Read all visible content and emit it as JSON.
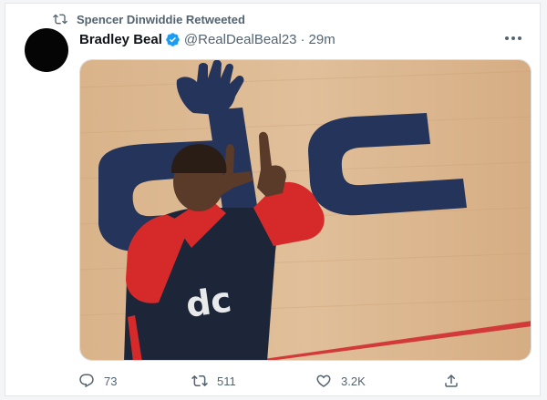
{
  "retweet": {
    "label": "Spencer Dinwiddie Retweeted",
    "icon": "retweet-icon"
  },
  "tweet": {
    "display_name": "Bradley Beal",
    "handle": "@RealDealBeal23",
    "separator": "·",
    "time": "29m",
    "verified": true,
    "image_jersey_text": "dc"
  },
  "actions": {
    "replies": "73",
    "retweets": "511",
    "likes": "3.2K"
  },
  "colors": {
    "verified": "#1d9bf0",
    "secondary_text": "#536471",
    "court_wood": "#d8b48b",
    "court_navy": "#24345a",
    "court_red": "#d23a3a",
    "jersey_navy": "#1d2638",
    "sleeve_red": "#d62a2a"
  }
}
